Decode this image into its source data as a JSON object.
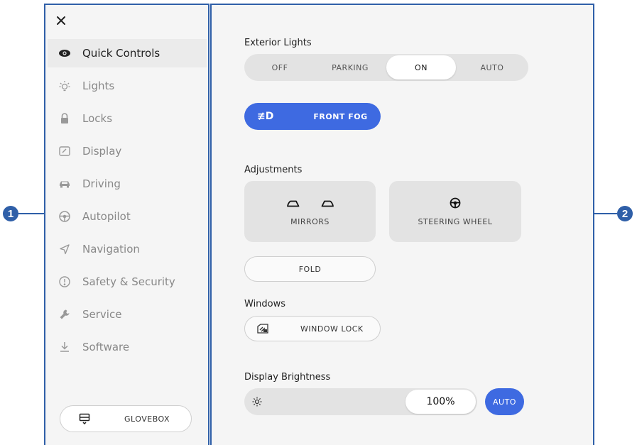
{
  "callouts": [
    "1",
    "2"
  ],
  "colors": {
    "accent": "#3e6ae1",
    "callout": "#2f5fa8"
  },
  "sidebar": {
    "close_icon": "close-icon",
    "items": [
      {
        "label": "Quick Controls",
        "icon": "eye-icon",
        "active": true
      },
      {
        "label": "Lights",
        "icon": "light-bulb-icon"
      },
      {
        "label": "Locks",
        "icon": "lock-icon"
      },
      {
        "label": "Display",
        "icon": "display-icon"
      },
      {
        "label": "Driving",
        "icon": "car-icon"
      },
      {
        "label": "Autopilot",
        "icon": "steering-wheel-icon"
      },
      {
        "label": "Navigation",
        "icon": "navigation-arrow-icon"
      },
      {
        "label": "Safety & Security",
        "icon": "alert-circle-icon"
      },
      {
        "label": "Service",
        "icon": "wrench-icon"
      },
      {
        "label": "Software",
        "icon": "download-icon"
      }
    ],
    "glovebox_label": "GLOVEBOX"
  },
  "main": {
    "exterior_lights": {
      "title": "Exterior Lights",
      "options": [
        "OFF",
        "PARKING",
        "ON",
        "AUTO"
      ],
      "selected": "ON"
    },
    "front_fog": {
      "label": "FRONT FOG",
      "icon_glyph": "≢D",
      "active": true
    },
    "adjustments": {
      "title": "Adjustments",
      "mirrors_label": "MIRRORS",
      "steering_label": "STEERING WHEEL",
      "fold_label": "FOLD"
    },
    "windows": {
      "title": "Windows",
      "lock_label": "WINDOW LOCK"
    },
    "display_brightness": {
      "title": "Display Brightness",
      "value": "100%",
      "level": 1.0,
      "auto_label": "AUTO"
    }
  }
}
